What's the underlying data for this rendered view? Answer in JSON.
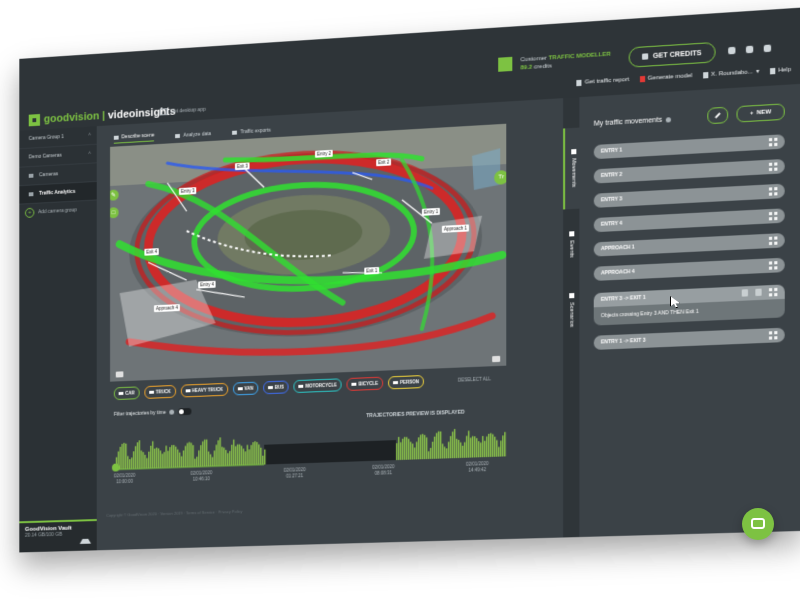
{
  "brand": {
    "name_a": "goodvision",
    "name_b": "videoinsights"
  },
  "header": {
    "desktop_app": "Get desktop app",
    "customer_label": "Customer",
    "plan": "TRAFFIC MODELLER",
    "credits_value": "89.2",
    "credits_label": "credits",
    "get_credits": "GET CREDITS",
    "toolbar": {
      "report": "Get traffic report",
      "model": "Generate model",
      "camera": "X. Roundabo...",
      "help": "Help"
    }
  },
  "sidebar": {
    "items": [
      {
        "label": "Camera Group 1"
      },
      {
        "label": "Demo Cameras"
      },
      {
        "label": "Cameras"
      },
      {
        "label": "Traffic Analytics"
      }
    ],
    "add_group": "Add camera group",
    "vault_title": "GoodVision Vault",
    "vault_size": "20.14 GB/100 GB"
  },
  "tabs": {
    "describe": "Describe scene",
    "analyze": "Analyze data",
    "exports": "Traffic exports"
  },
  "video": {
    "labels": [
      "Exit 3",
      "Entry 2",
      "Exit 2",
      "Entry 3",
      "Entry 1",
      "Exit 4",
      "Exit 1",
      "Entry 4",
      "Approach 1",
      "Approach 4"
    ],
    "tr_button": "Tr"
  },
  "classes": [
    {
      "label": "CAR",
      "color": "#7dc242"
    },
    {
      "label": "TRUCK",
      "color": "#f4a62a"
    },
    {
      "label": "HEAVY TRUCK",
      "color": "#f4a62a"
    },
    {
      "label": "VAN",
      "color": "#3fa9f5"
    },
    {
      "label": "BUS",
      "color": "#3f6ef5"
    },
    {
      "label": "MOTORCYCLE",
      "color": "#2cc6c6"
    },
    {
      "label": "BICYCLE",
      "color": "#e53935"
    },
    {
      "label": "PERSON",
      "color": "#f2d43a"
    }
  ],
  "deselect_all": "DESELECT ALL",
  "filter_label": "Filter trajectories by time",
  "preview_label": "TRAJECTORIES PREVIEW IS DISPLAYED",
  "timeline_times": [
    "02/01/2020\n10:00:00",
    "02/01/2020\n10:46:10",
    "02/01/2020\n01:27:21",
    "02/01/2020\n08:08:31",
    "02/01/2020\n14:49:42"
  ],
  "copyright": "Copyright © GoodVision 2020 · Version 2019 · Terms of Service · Privacy Policy",
  "right_tabs": {
    "movements": "Movements",
    "events": "Events",
    "scenarios": "Scenarios"
  },
  "movements": {
    "title": "My traffic movements",
    "new_label": "NEW",
    "items": [
      {
        "label": "ENTRY 1"
      },
      {
        "label": "ENTRY 2"
      },
      {
        "label": "ENTRY 3"
      },
      {
        "label": "ENTRY 4"
      },
      {
        "label": "APPROACH 1"
      },
      {
        "label": "APPROACH 4"
      },
      {
        "label": "ENTRY 3 -> EXIT 1",
        "description": "Objects crossing Entry 3 AND THEN Exit 1"
      },
      {
        "label": "ENTRY 1 -> EXIT 3"
      }
    ]
  }
}
